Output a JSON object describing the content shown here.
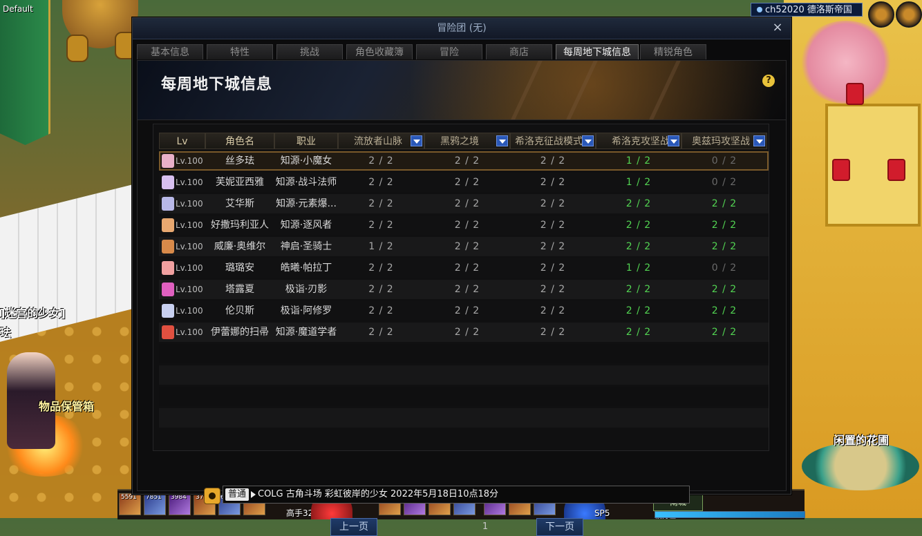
{
  "hud": {
    "top_left_label": "Default",
    "server": "ch52020 德洛斯帝国",
    "npc_labels": {
      "left_npc_title": "]迷宫的少女]",
      "left_npc_name": "珐",
      "storage": "物品保管箱",
      "garden": "闲置的花圃"
    },
    "hotbar": {
      "slot_numbers": [
        "5591",
        "7851",
        "3984",
        "3732",
        "623",
        "6"
      ],
      "rank_label": "高手32",
      "town_button": "南城",
      "fatigue_label": "疲劳值",
      "level_badge": "37",
      "sp_label": "SP5",
      "fatigue_fraction": 1.0
    }
  },
  "dialog": {
    "title": "冒险团 (无)",
    "close_glyph": "×",
    "tabs": [
      {
        "label": "基本信息",
        "active": false
      },
      {
        "label": "特性",
        "active": false
      },
      {
        "label": "挑战",
        "active": false
      },
      {
        "label": "角色收藏簿",
        "active": false
      },
      {
        "label": "冒险",
        "active": false
      },
      {
        "label": "商店",
        "active": false
      },
      {
        "label": "每周地下城信息",
        "active": true
      },
      {
        "label": "精锐角色",
        "active": false
      }
    ],
    "panel_title": "每周地下城信息",
    "help_glyph": "?",
    "table": {
      "headers": {
        "lv": "Lv",
        "name": "角色名",
        "job": "职业",
        "d1": "流放者山脉",
        "d2": "黑鸦之境",
        "d3": "希洛克征战模式",
        "d4": "希洛克攻坚战",
        "d5": "奥兹玛攻坚战"
      },
      "rows": [
        {
          "lv": "Lv.100",
          "name": "丝多珐",
          "job": "知源·小魔女",
          "d1": "2 / 2",
          "d2": "2 / 2",
          "d3": "2 / 2",
          "d4": "1 / 2",
          "d5": "0 / 2",
          "avatar": "#e8b0c8"
        },
        {
          "lv": "Lv.100",
          "name": "芙妮亚西雅",
          "job": "知源·战斗法师",
          "d1": "2 / 2",
          "d2": "2 / 2",
          "d3": "2 / 2",
          "d4": "1 / 2",
          "d5": "0 / 2",
          "avatar": "#d8c0f0"
        },
        {
          "lv": "Lv.100",
          "name": "艾华斯",
          "job": "知源·元素爆...",
          "d1": "2 / 2",
          "d2": "2 / 2",
          "d3": "2 / 2",
          "d4": "2 / 2",
          "d5": "2 / 2",
          "avatar": "#b8b8e8"
        },
        {
          "lv": "Lv.100",
          "name": "好撒玛利亚人",
          "job": "知源·逐风者",
          "d1": "2 / 2",
          "d2": "2 / 2",
          "d3": "2 / 2",
          "d4": "2 / 2",
          "d5": "2 / 2",
          "avatar": "#e8a870"
        },
        {
          "lv": "Lv.100",
          "name": "威廉·奥维尔",
          "job": "神启·圣骑士",
          "d1": "1 / 2",
          "d2": "2 / 2",
          "d3": "2 / 2",
          "d4": "2 / 2",
          "d5": "2 / 2",
          "avatar": "#d88a4a"
        },
        {
          "lv": "Lv.100",
          "name": "璐璐安",
          "job": "皓曦·帕拉丁",
          "d1": "2 / 2",
          "d2": "2 / 2",
          "d3": "2 / 2",
          "d4": "1 / 2",
          "d5": "0 / 2",
          "avatar": "#f0a0a0"
        },
        {
          "lv": "Lv.100",
          "name": "塔露夏",
          "job": "极诣·刃影",
          "d1": "2 / 2",
          "d2": "2 / 2",
          "d3": "2 / 2",
          "d4": "2 / 2",
          "d5": "2 / 2",
          "avatar": "#e060c0"
        },
        {
          "lv": "Lv.100",
          "name": "伦贝斯",
          "job": "极诣·阿修罗",
          "d1": "2 / 2",
          "d2": "2 / 2",
          "d3": "2 / 2",
          "d4": "2 / 2",
          "d5": "2 / 2",
          "avatar": "#c8d0f0"
        },
        {
          "lv": "Lv.100",
          "name": "伊蕾娜的扫帚",
          "job": "知源·魔道学者",
          "d1": "2 / 2",
          "d2": "2 / 2",
          "d3": "2 / 2",
          "d4": "2 / 2",
          "d5": "2 / 2",
          "avatar": "#e05040"
        }
      ]
    },
    "chat": {
      "channel": "普通",
      "message": "COLG 古角斗场 彩虹彼岸的少女 2022年5月18日10点18分"
    },
    "pager": {
      "prev": "上一页",
      "page": "1",
      "next": "下一页"
    }
  },
  "colors": {
    "complete_green": "#52d452",
    "zero_gray": "#6a6a6a",
    "tab_active": "#f0f0f0",
    "button_blue": "#1f3a68"
  }
}
